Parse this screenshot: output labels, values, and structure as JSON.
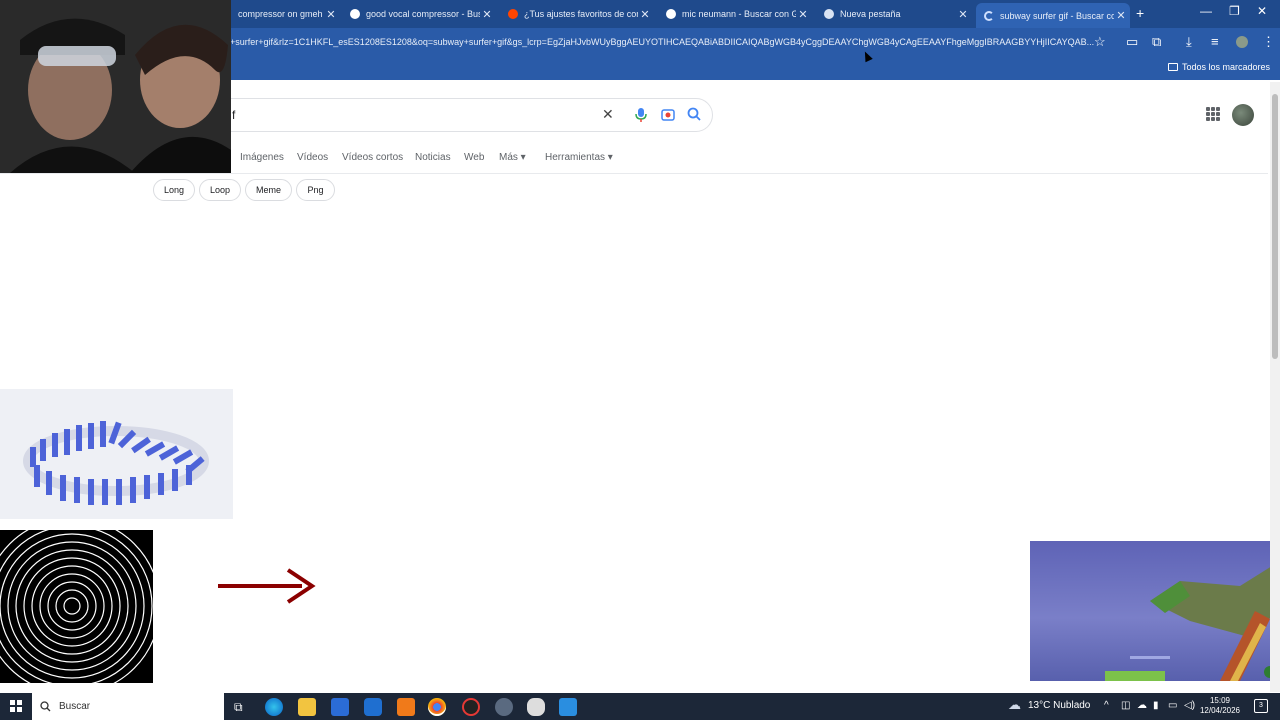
{
  "browser": {
    "tabs": [
      {
        "title": "compressor on gmeh - Bu",
        "active": false
      },
      {
        "title": "good vocal compressor - Busca",
        "active": false
      },
      {
        "title": "¿Tus ajustes favoritos de comp",
        "active": false
      },
      {
        "title": "mic neumann - Buscar con Goo",
        "active": false
      },
      {
        "title": "Nueva pestaña",
        "active": false
      },
      {
        "title": "subway surfer gif - Buscar con",
        "active": true
      }
    ],
    "new_tab": "+",
    "url": "+surfer+gif&rlz=1C1HKFL_esES1208ES1208&oq=subway+surfer+gif&gs_lcrp=EgZjaHJvbWUyBggAEUYOTIHCAEQABiABDIICAIQABgWGB4yCggDEAAYChgWGB4yCAgEEAAYFhgeMggIBRAAGBYYHjIICAYQAB...",
    "bookmarks_label": "Todos los marcadores",
    "window_controls": {
      "minimize": "—",
      "restore": "❐",
      "close": "✕"
    }
  },
  "search": {
    "query_fragment": "f",
    "clear_symbol": "✕",
    "nav_tabs": [
      "Imágenes",
      "Vídeos",
      "Vídeos cortos",
      "Noticias",
      "Web",
      "Más",
      "Herramientas"
    ],
    "chips": [
      "Long",
      "Loop",
      "Meme",
      "Png"
    ]
  },
  "taskbar": {
    "search_placeholder": "Buscar",
    "weather": "13°C  Nublado",
    "time": "15:09",
    "date": "12/04/2026",
    "notifications": "3"
  },
  "colors": {
    "chrome_dark": "#1f4a8c",
    "chrome": "#2a5ba8",
    "arrow_red": "#8b0000",
    "domino_blue": "#4d63d8"
  }
}
